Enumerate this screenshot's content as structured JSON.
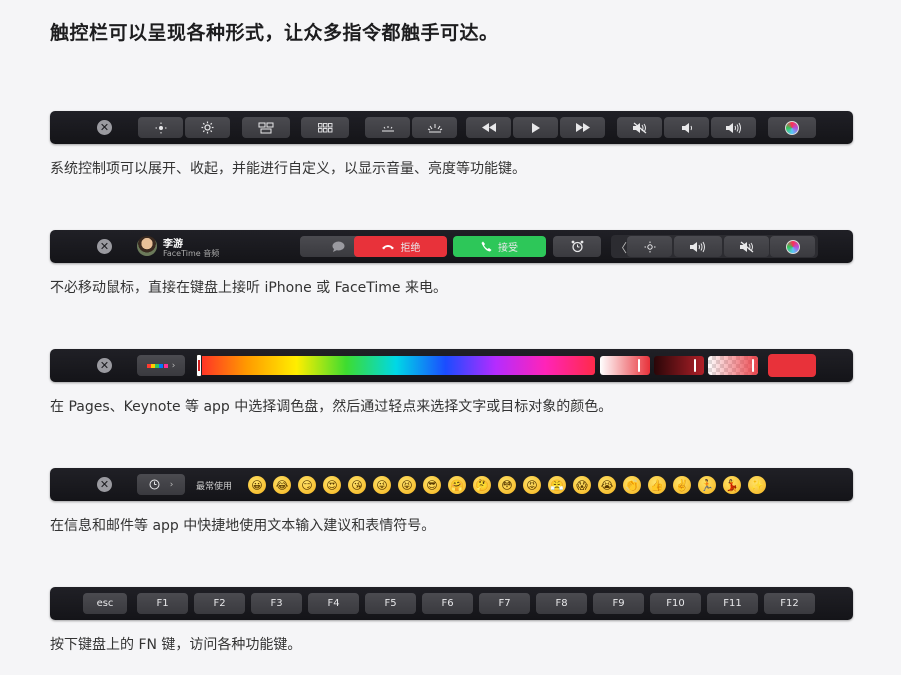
{
  "heading": "触控栏可以呈现各种形式，让众多指令都触手可达。",
  "captions": {
    "c1": "系统控制项可以展开、收起，并能进行自定义，以显示音量、亮度等功能键。",
    "c2": "不必移动鼠标，直接在键盘上接听 iPhone 或 FaceTime 来电。",
    "c3": "在 Pages、Keynote 等 app 中选择调色盘，然后通过轻点来选择文字或目标对象的颜色。",
    "c4": "在信息和邮件等 app 中快捷地使用文本输入建议和表情符号。",
    "c5": "按下键盘上的 FN 键，访问各种功能键。"
  },
  "call": {
    "caller_name": "李游",
    "caller_sub": "FaceTime 音频",
    "decline_label": "拒绝",
    "accept_label": "接受",
    "decline_color": "#e8323a",
    "accept_color": "#2dc759"
  },
  "emoji_bar": {
    "section_label": "最常使用",
    "emojis": [
      "😀",
      "😂",
      "😏",
      "😍",
      "😘",
      "😜",
      "😝",
      "😎",
      "🤗",
      "🤔",
      "😳",
      "😡",
      "😤",
      "😱",
      "😭",
      "👏",
      "👍",
      "✌️",
      "🏃",
      "💃",
      "✨"
    ]
  },
  "fn_keys": [
    "esc",
    "F1",
    "F2",
    "F3",
    "F4",
    "F5",
    "F6",
    "F7",
    "F8",
    "F9",
    "F10",
    "F11",
    "F12"
  ],
  "color_selected": "#e8323a"
}
